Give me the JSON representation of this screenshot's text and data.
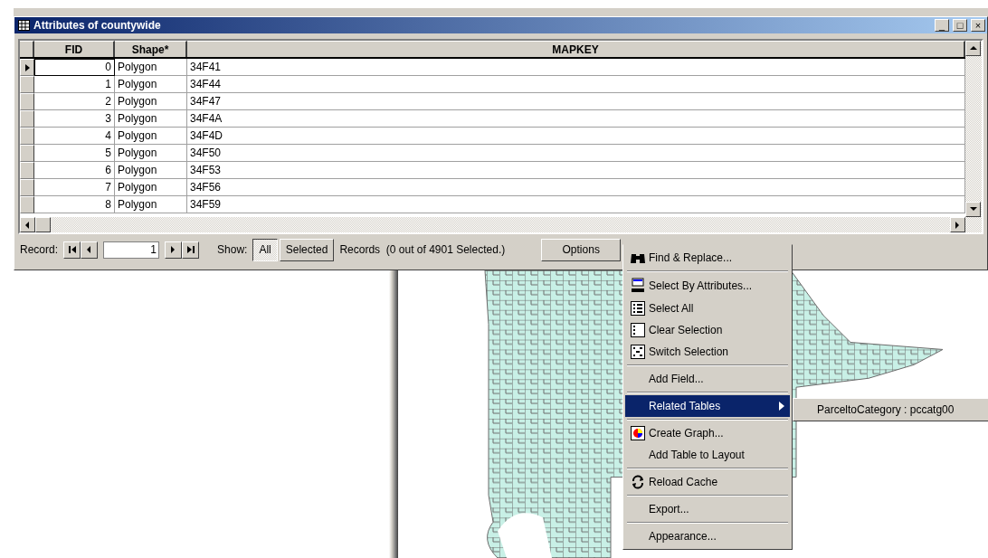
{
  "window": {
    "title": "Attributes of countywide",
    "controls": [
      "_",
      "□",
      "×"
    ]
  },
  "table": {
    "columns": [
      "FID",
      "Shape*",
      "MAPKEY"
    ],
    "rows": [
      {
        "fid": "0",
        "shape": "Polygon",
        "mapkey": "34F41",
        "selected": true
      },
      {
        "fid": "1",
        "shape": "Polygon",
        "mapkey": "34F44",
        "selected": false
      },
      {
        "fid": "2",
        "shape": "Polygon",
        "mapkey": "34F47",
        "selected": false
      },
      {
        "fid": "3",
        "shape": "Polygon",
        "mapkey": "34F4A",
        "selected": false
      },
      {
        "fid": "4",
        "shape": "Polygon",
        "mapkey": "34F4D",
        "selected": false
      },
      {
        "fid": "5",
        "shape": "Polygon",
        "mapkey": "34F50",
        "selected": false
      },
      {
        "fid": "6",
        "shape": "Polygon",
        "mapkey": "34F53",
        "selected": false
      },
      {
        "fid": "7",
        "shape": "Polygon",
        "mapkey": "34F56",
        "selected": false
      },
      {
        "fid": "8",
        "shape": "Polygon",
        "mapkey": "34F59",
        "selected": false
      }
    ]
  },
  "footer": {
    "record_label": "Record:",
    "record_value": "1",
    "show_label": "Show:",
    "show_buttons": [
      {
        "label": "All",
        "selected": true
      },
      {
        "label": "Selected",
        "selected": false
      }
    ],
    "records_text": "Records  (0 out of 4901 Selected.)",
    "options": "Options"
  },
  "menu": {
    "items": [
      {
        "kind": "item",
        "label": "Find & Replace...",
        "selected": false,
        "submenu": false
      },
      {
        "kind": "separator"
      },
      {
        "kind": "item",
        "label": "Select By Attributes...",
        "selected": false,
        "submenu": false
      },
      {
        "kind": "item",
        "label": "Select All",
        "selected": false,
        "submenu": false
      },
      {
        "kind": "item",
        "label": "Clear Selection",
        "selected": false,
        "submenu": false
      },
      {
        "kind": "item",
        "label": "Switch Selection",
        "selected": false,
        "submenu": false
      },
      {
        "kind": "separator"
      },
      {
        "kind": "item",
        "label": "Add Field...",
        "selected": false,
        "submenu": false
      },
      {
        "kind": "separator"
      },
      {
        "kind": "item",
        "label": "Related Tables",
        "selected": true,
        "submenu": true
      },
      {
        "kind": "separator"
      },
      {
        "kind": "item",
        "label": "Create Graph...",
        "selected": false,
        "submenu": false
      },
      {
        "kind": "item",
        "label": "Add Table to Layout",
        "selected": false,
        "submenu": false
      },
      {
        "kind": "separator"
      },
      {
        "kind": "item",
        "label": "Reload Cache",
        "selected": false,
        "submenu": false
      },
      {
        "kind": "separator"
      },
      {
        "kind": "item",
        "label": "Export...",
        "selected": false,
        "submenu": false
      },
      {
        "kind": "separator"
      },
      {
        "kind": "item",
        "label": "Appearance...",
        "selected": false,
        "submenu": false
      }
    ],
    "submenu_items": [
      "ParceltoCategory : pccatg00"
    ]
  }
}
